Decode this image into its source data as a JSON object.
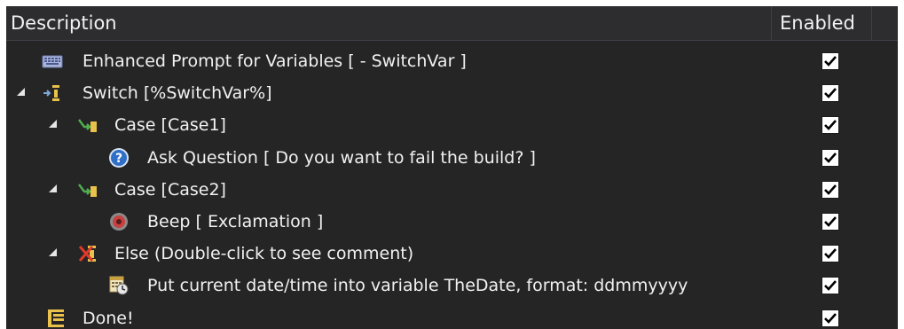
{
  "header": {
    "description": "Description",
    "enabled": "Enabled"
  },
  "rows": [
    {
      "label": "Enhanced Prompt for Variables [  - SwitchVar ]",
      "icon": "keyboard-icon",
      "enabled": true,
      "expanded": null
    },
    {
      "label": "Switch [%SwitchVar%]",
      "icon": "switch-icon",
      "enabled": true,
      "expanded": true
    },
    {
      "label": "Case [Case1]",
      "icon": "case-icon",
      "enabled": true,
      "expanded": true
    },
    {
      "label": "Ask Question [ Do you want to fail the build? ]",
      "icon": "question-icon",
      "enabled": true,
      "expanded": null
    },
    {
      "label": "Case [Case2]",
      "icon": "case-icon",
      "enabled": true,
      "expanded": true
    },
    {
      "label": "Beep [ Exclamation ]",
      "icon": "speaker-icon",
      "enabled": true,
      "expanded": null
    },
    {
      "label": "Else (Double-click to see comment)",
      "icon": "else-icon",
      "enabled": true,
      "expanded": true
    },
    {
      "label": "Put current date/time into variable TheDate, format: ddmmyyyy",
      "icon": "calendar-clock-icon",
      "enabled": true,
      "expanded": null
    },
    {
      "label": "Done!",
      "icon": "done-icon",
      "enabled": true,
      "expanded": null
    }
  ],
  "colors": {
    "background": "#252526",
    "text": "#f1f1f1",
    "header": "#2d2d30"
  }
}
